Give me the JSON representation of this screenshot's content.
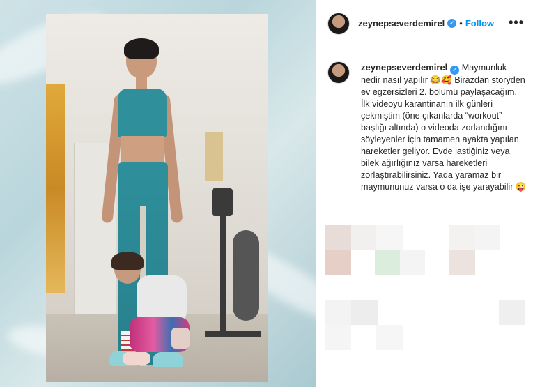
{
  "post": {
    "username": "zeynepseverdemirel",
    "follow_label": "Follow",
    "separator": "•",
    "more_label": "•••",
    "verified_mark": "✓",
    "caption_text": " Maymunluk nedir nasıl yapılır 😂🥰 Birazdan storyden ev egzersizleri 2. bölümü paylaşacağım. İlk videoyu karantinanın ilk günleri çekmiştim (öne çıkanlarda “workout” başlığı altında) o videoda zorlandığını söyleyenler için tamamen ayakta yapılan hareketler geliyor. Evde lastiğiniz veya bilek ağırlığınız varsa hareketleri zorlaştırabilirsiniz. Yada yaramaz bir maymununuz varsa o da işe yarayabilir 😜"
  },
  "colors": {
    "accent": "#0095f6",
    "verified": "#3897f0",
    "leggings": "#2e8f9b"
  },
  "icons": [
    "verified-badge-icon",
    "more-options-icon"
  ]
}
